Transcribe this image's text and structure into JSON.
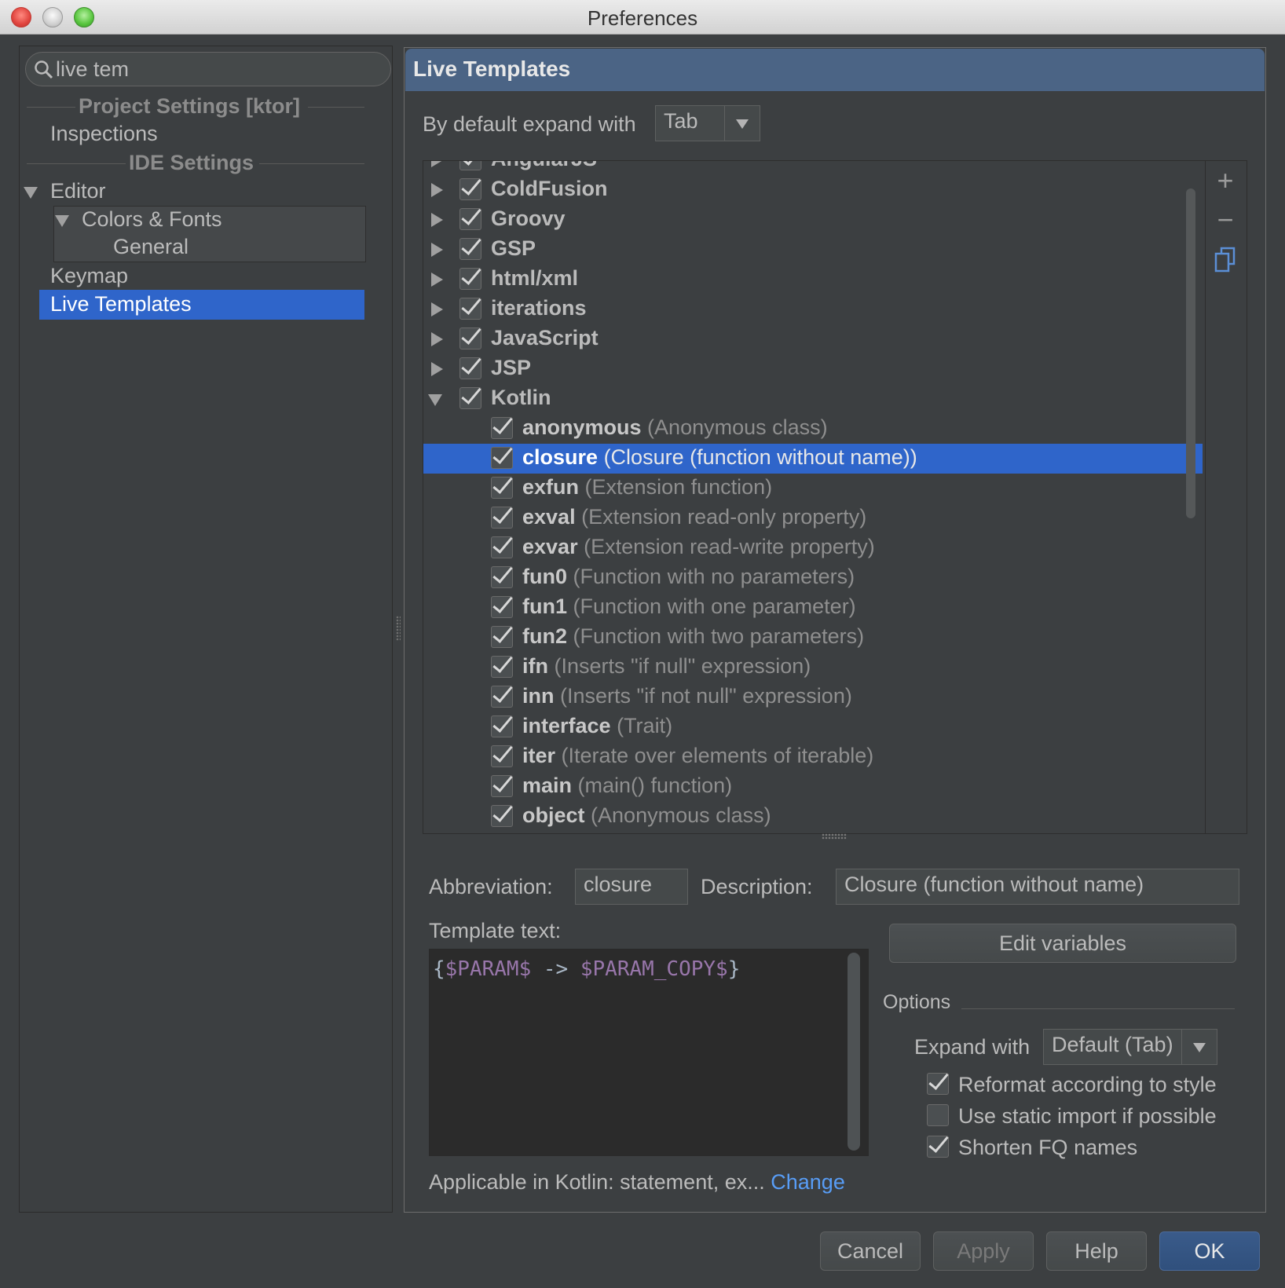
{
  "window": {
    "title": "Preferences"
  },
  "search": {
    "value": "live tem"
  },
  "sidebar": {
    "project_header": "Project Settings [ktor]",
    "ide_header": "IDE Settings",
    "items": [
      {
        "label": "Inspections"
      },
      {
        "label": "Editor"
      },
      {
        "label": "Colors & Fonts"
      },
      {
        "label": "General"
      },
      {
        "label": "Keymap"
      },
      {
        "label": "Live Templates"
      }
    ],
    "selected": "Live Templates"
  },
  "panel": {
    "title": "Live Templates",
    "expand_label": "By default expand with",
    "expand_value": "Tab"
  },
  "groups": [
    {
      "label": "AngularJS"
    },
    {
      "label": "ColdFusion"
    },
    {
      "label": "Groovy"
    },
    {
      "label": "GSP"
    },
    {
      "label": "html/xml"
    },
    {
      "label": "iterations"
    },
    {
      "label": "JavaScript"
    },
    {
      "label": "JSP"
    },
    {
      "label": "Kotlin"
    }
  ],
  "templates": [
    {
      "abbr": "anonymous",
      "desc": "(Anonymous class)"
    },
    {
      "abbr": "closure",
      "desc": "(Closure (function without name))"
    },
    {
      "abbr": "exfun",
      "desc": "(Extension function)"
    },
    {
      "abbr": "exval",
      "desc": "(Extension read-only property)"
    },
    {
      "abbr": "exvar",
      "desc": "(Extension read-write property)"
    },
    {
      "abbr": "fun0",
      "desc": "(Function with no parameters)"
    },
    {
      "abbr": "fun1",
      "desc": "(Function with one parameter)"
    },
    {
      "abbr": "fun2",
      "desc": "(Function with two parameters)"
    },
    {
      "abbr": "ifn",
      "desc": "(Inserts \"if null\" expression)"
    },
    {
      "abbr": "inn",
      "desc": "(Inserts \"if not null\" expression)"
    },
    {
      "abbr": "interface",
      "desc": "(Trait)"
    },
    {
      "abbr": "iter",
      "desc": "(Iterate over elements of iterable)"
    },
    {
      "abbr": "main",
      "desc": "(main() function)"
    },
    {
      "abbr": "object",
      "desc": "(Anonymous class)"
    }
  ],
  "selected_template": "closure",
  "toolbar": {
    "add_icon": "+",
    "remove_icon": "−",
    "copy_icon": "copy-icon"
  },
  "detail": {
    "abbreviation_label": "Abbreviation:",
    "abbreviation_value": "closure",
    "description_label": "Description:",
    "description_value": "Closure (function without name)",
    "template_text_label": "Template text:",
    "code_open": "{",
    "code_var1": "$PARAM$",
    "code_arrow": " -> ",
    "code_var2": "$PARAM_COPY$",
    "code_close": "}",
    "edit_variables": "Edit variables",
    "options_label": "Options",
    "expand_with_label": "Expand with",
    "expand_with_value": "Default (Tab)",
    "reformat_label": "Reformat according to style",
    "reformat_checked": true,
    "static_import_label": "Use static import if possible",
    "static_import_checked": false,
    "shorten_label": "Shorten FQ names",
    "shorten_checked": true,
    "applicable_text": "Applicable in Kotlin: statement, ex...",
    "change_link": "Change"
  },
  "buttons": {
    "cancel": "Cancel",
    "apply": "Apply",
    "help": "Help",
    "ok": "OK"
  },
  "colors": {
    "background": "#3c3f41",
    "selection": "#2f65ca",
    "header": "#4b6485",
    "link": "#589df6"
  }
}
